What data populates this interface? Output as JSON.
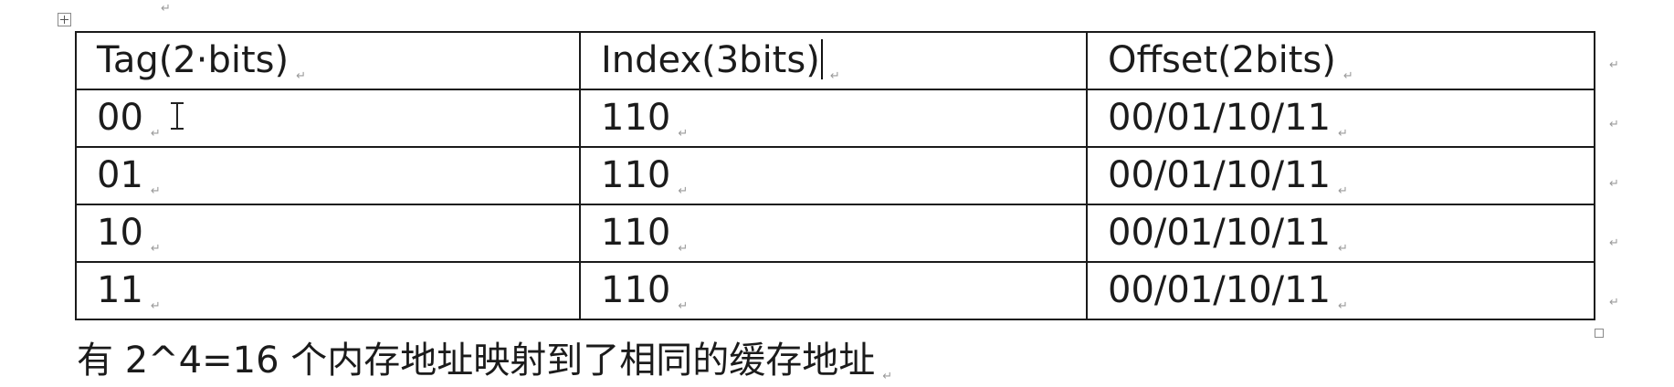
{
  "para_mark": "↵",
  "table": {
    "headers": [
      "Tag(2·bits)",
      "Index(3bits)",
      "Offset(2bits)"
    ],
    "rows": [
      [
        "00",
        "110",
        "00/01/10/11"
      ],
      [
        "01",
        "110",
        "00/01/10/11"
      ],
      [
        "10",
        "110",
        "00/01/10/11"
      ],
      [
        "11",
        "110",
        "00/01/10/11"
      ]
    ]
  },
  "caption": "有 2^4=16 个内存地址映射到了相同的缓存地址"
}
